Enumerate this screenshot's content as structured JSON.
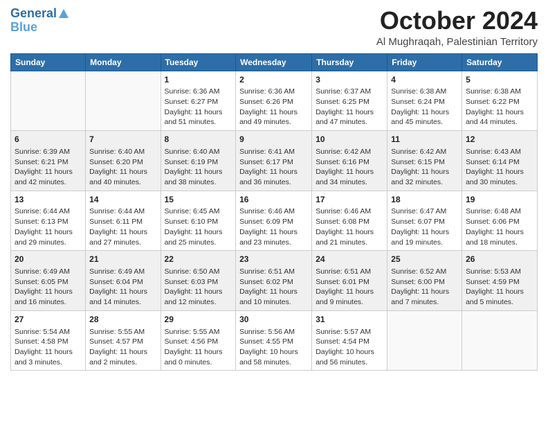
{
  "header": {
    "logo_line1": "General",
    "logo_line2": "Blue",
    "month": "October 2024",
    "location": "Al Mughraqah, Palestinian Territory"
  },
  "days_of_week": [
    "Sunday",
    "Monday",
    "Tuesday",
    "Wednesday",
    "Thursday",
    "Friday",
    "Saturday"
  ],
  "weeks": [
    [
      {
        "day": "",
        "sunrise": "",
        "sunset": "",
        "daylight": ""
      },
      {
        "day": "",
        "sunrise": "",
        "sunset": "",
        "daylight": ""
      },
      {
        "day": "1",
        "sunrise": "Sunrise: 6:36 AM",
        "sunset": "Sunset: 6:27 PM",
        "daylight": "Daylight: 11 hours and 51 minutes."
      },
      {
        "day": "2",
        "sunrise": "Sunrise: 6:36 AM",
        "sunset": "Sunset: 6:26 PM",
        "daylight": "Daylight: 11 hours and 49 minutes."
      },
      {
        "day": "3",
        "sunrise": "Sunrise: 6:37 AM",
        "sunset": "Sunset: 6:25 PM",
        "daylight": "Daylight: 11 hours and 47 minutes."
      },
      {
        "day": "4",
        "sunrise": "Sunrise: 6:38 AM",
        "sunset": "Sunset: 6:24 PM",
        "daylight": "Daylight: 11 hours and 45 minutes."
      },
      {
        "day": "5",
        "sunrise": "Sunrise: 6:38 AM",
        "sunset": "Sunset: 6:22 PM",
        "daylight": "Daylight: 11 hours and 44 minutes."
      }
    ],
    [
      {
        "day": "6",
        "sunrise": "Sunrise: 6:39 AM",
        "sunset": "Sunset: 6:21 PM",
        "daylight": "Daylight: 11 hours and 42 minutes."
      },
      {
        "day": "7",
        "sunrise": "Sunrise: 6:40 AM",
        "sunset": "Sunset: 6:20 PM",
        "daylight": "Daylight: 11 hours and 40 minutes."
      },
      {
        "day": "8",
        "sunrise": "Sunrise: 6:40 AM",
        "sunset": "Sunset: 6:19 PM",
        "daylight": "Daylight: 11 hours and 38 minutes."
      },
      {
        "day": "9",
        "sunrise": "Sunrise: 6:41 AM",
        "sunset": "Sunset: 6:17 PM",
        "daylight": "Daylight: 11 hours and 36 minutes."
      },
      {
        "day": "10",
        "sunrise": "Sunrise: 6:42 AM",
        "sunset": "Sunset: 6:16 PM",
        "daylight": "Daylight: 11 hours and 34 minutes."
      },
      {
        "day": "11",
        "sunrise": "Sunrise: 6:42 AM",
        "sunset": "Sunset: 6:15 PM",
        "daylight": "Daylight: 11 hours and 32 minutes."
      },
      {
        "day": "12",
        "sunrise": "Sunrise: 6:43 AM",
        "sunset": "Sunset: 6:14 PM",
        "daylight": "Daylight: 11 hours and 30 minutes."
      }
    ],
    [
      {
        "day": "13",
        "sunrise": "Sunrise: 6:44 AM",
        "sunset": "Sunset: 6:13 PM",
        "daylight": "Daylight: 11 hours and 29 minutes."
      },
      {
        "day": "14",
        "sunrise": "Sunrise: 6:44 AM",
        "sunset": "Sunset: 6:11 PM",
        "daylight": "Daylight: 11 hours and 27 minutes."
      },
      {
        "day": "15",
        "sunrise": "Sunrise: 6:45 AM",
        "sunset": "Sunset: 6:10 PM",
        "daylight": "Daylight: 11 hours and 25 minutes."
      },
      {
        "day": "16",
        "sunrise": "Sunrise: 6:46 AM",
        "sunset": "Sunset: 6:09 PM",
        "daylight": "Daylight: 11 hours and 23 minutes."
      },
      {
        "day": "17",
        "sunrise": "Sunrise: 6:46 AM",
        "sunset": "Sunset: 6:08 PM",
        "daylight": "Daylight: 11 hours and 21 minutes."
      },
      {
        "day": "18",
        "sunrise": "Sunrise: 6:47 AM",
        "sunset": "Sunset: 6:07 PM",
        "daylight": "Daylight: 11 hours and 19 minutes."
      },
      {
        "day": "19",
        "sunrise": "Sunrise: 6:48 AM",
        "sunset": "Sunset: 6:06 PM",
        "daylight": "Daylight: 11 hours and 18 minutes."
      }
    ],
    [
      {
        "day": "20",
        "sunrise": "Sunrise: 6:49 AM",
        "sunset": "Sunset: 6:05 PM",
        "daylight": "Daylight: 11 hours and 16 minutes."
      },
      {
        "day": "21",
        "sunrise": "Sunrise: 6:49 AM",
        "sunset": "Sunset: 6:04 PM",
        "daylight": "Daylight: 11 hours and 14 minutes."
      },
      {
        "day": "22",
        "sunrise": "Sunrise: 6:50 AM",
        "sunset": "Sunset: 6:03 PM",
        "daylight": "Daylight: 11 hours and 12 minutes."
      },
      {
        "day": "23",
        "sunrise": "Sunrise: 6:51 AM",
        "sunset": "Sunset: 6:02 PM",
        "daylight": "Daylight: 11 hours and 10 minutes."
      },
      {
        "day": "24",
        "sunrise": "Sunrise: 6:51 AM",
        "sunset": "Sunset: 6:01 PM",
        "daylight": "Daylight: 11 hours and 9 minutes."
      },
      {
        "day": "25",
        "sunrise": "Sunrise: 6:52 AM",
        "sunset": "Sunset: 6:00 PM",
        "daylight": "Daylight: 11 hours and 7 minutes."
      },
      {
        "day": "26",
        "sunrise": "Sunrise: 5:53 AM",
        "sunset": "Sunset: 4:59 PM",
        "daylight": "Daylight: 11 hours and 5 minutes."
      }
    ],
    [
      {
        "day": "27",
        "sunrise": "Sunrise: 5:54 AM",
        "sunset": "Sunset: 4:58 PM",
        "daylight": "Daylight: 11 hours and 3 minutes."
      },
      {
        "day": "28",
        "sunrise": "Sunrise: 5:55 AM",
        "sunset": "Sunset: 4:57 PM",
        "daylight": "Daylight: 11 hours and 2 minutes."
      },
      {
        "day": "29",
        "sunrise": "Sunrise: 5:55 AM",
        "sunset": "Sunset: 4:56 PM",
        "daylight": "Daylight: 11 hours and 0 minutes."
      },
      {
        "day": "30",
        "sunrise": "Sunrise: 5:56 AM",
        "sunset": "Sunset: 4:55 PM",
        "daylight": "Daylight: 10 hours and 58 minutes."
      },
      {
        "day": "31",
        "sunrise": "Sunrise: 5:57 AM",
        "sunset": "Sunset: 4:54 PM",
        "daylight": "Daylight: 10 hours and 56 minutes."
      },
      {
        "day": "",
        "sunrise": "",
        "sunset": "",
        "daylight": ""
      },
      {
        "day": "",
        "sunrise": "",
        "sunset": "",
        "daylight": ""
      }
    ]
  ]
}
